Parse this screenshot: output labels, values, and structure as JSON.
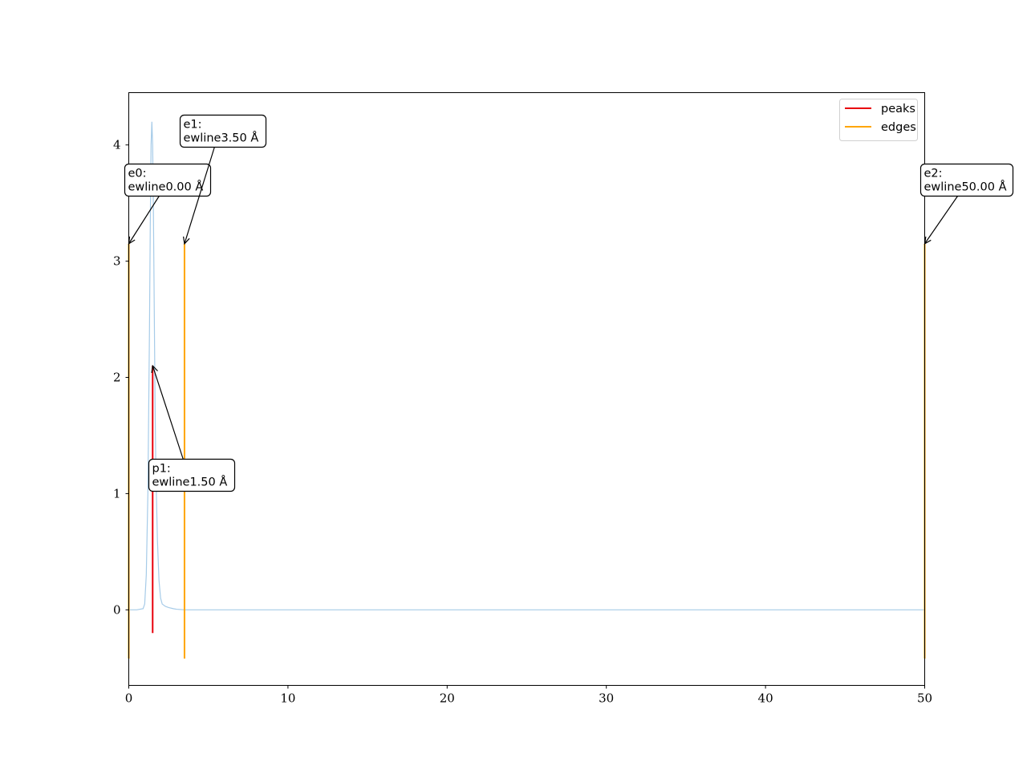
{
  "chart_data": {
    "type": "line",
    "title": "",
    "xlabel": "",
    "ylabel": "",
    "xlim": [
      0,
      50
    ],
    "ylim": [
      -0.65,
      4.45
    ],
    "xticks": [
      0,
      10,
      20,
      30,
      40,
      50
    ],
    "yticks": [
      0,
      1,
      2,
      3,
      4
    ],
    "grid": false,
    "legend_position": "top-right",
    "colors": {
      "spectrum": "#a6cbe8",
      "peaks": "#e8000b",
      "edges": "#ffa500"
    },
    "spectrum": {
      "x": [
        0,
        0.5,
        0.9,
        1.0,
        1.1,
        1.2,
        1.3,
        1.35,
        1.4,
        1.45,
        1.5,
        1.55,
        1.6,
        1.65,
        1.7,
        1.8,
        1.9,
        2.0,
        2.1,
        2.3,
        2.5,
        2.8,
        3.0,
        3.5,
        5,
        10,
        20,
        30,
        40,
        50
      ],
      "y": [
        0,
        0,
        0.01,
        0.05,
        0.3,
        1.0,
        2.4,
        3.3,
        4.0,
        4.2,
        4.0,
        3.4,
        2.6,
        1.8,
        1.2,
        0.6,
        0.25,
        0.1,
        0.05,
        0.03,
        0.02,
        0.01,
        0.005,
        0,
        0,
        0,
        0,
        0,
        0,
        0
      ]
    },
    "series": [
      {
        "name": "peaks",
        "lines": [
          {
            "x": 1.5,
            "ymin": -0.2,
            "ymax": 2.1
          }
        ]
      },
      {
        "name": "edges",
        "lines": [
          {
            "x": 0.0,
            "ymin": -0.42,
            "ymax": 3.15
          },
          {
            "x": 3.5,
            "ymin": -0.42,
            "ymax": 3.15
          },
          {
            "x": 50.0,
            "ymin": -0.42,
            "ymax": 3.15
          }
        ]
      }
    ],
    "annotations": [
      {
        "id": "e0",
        "line1": "e0:",
        "line2": "ewline0.00 Å",
        "target_x": 0.0,
        "target_y": 3.15
      },
      {
        "id": "e1",
        "line1": "e1:",
        "line2": "ewline3.50 Å",
        "target_x": 3.5,
        "target_y": 3.15
      },
      {
        "id": "e2",
        "line1": "e2:",
        "line2": "ewline50.00 Å",
        "target_x": 50.0,
        "target_y": 3.15
      },
      {
        "id": "p1",
        "line1": "p1:",
        "line2": "ewline1.50 Å",
        "target_x": 1.5,
        "target_y": 2.1
      }
    ],
    "legend": [
      "peaks",
      "edges"
    ]
  }
}
